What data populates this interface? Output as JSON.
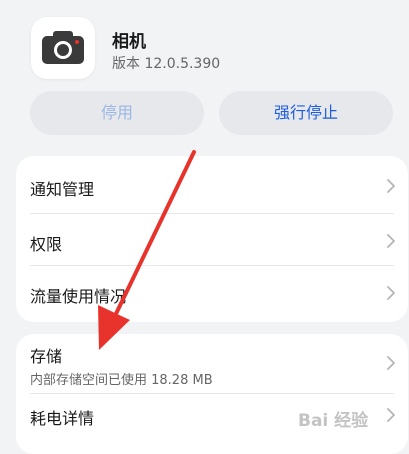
{
  "app": {
    "name": "相机",
    "version": "版本 12.0.5.390"
  },
  "actions": {
    "disable_label": "停用",
    "force_stop_label": "强行停止"
  },
  "card1": {
    "items": [
      {
        "label": "通知管理"
      },
      {
        "label": "权限"
      },
      {
        "label": "流量使用情况"
      }
    ]
  },
  "card2": {
    "storage": {
      "label": "存储",
      "detail": "内部存储空间已使用 18.28 MB"
    },
    "battery": {
      "label": "耗电详情"
    }
  },
  "colors": {
    "accent": "#1e5ce0",
    "disabled_text": "#9cb6e6",
    "annotation_arrow": "#e8332c"
  },
  "watermark": {
    "text": "Bai 经验"
  }
}
